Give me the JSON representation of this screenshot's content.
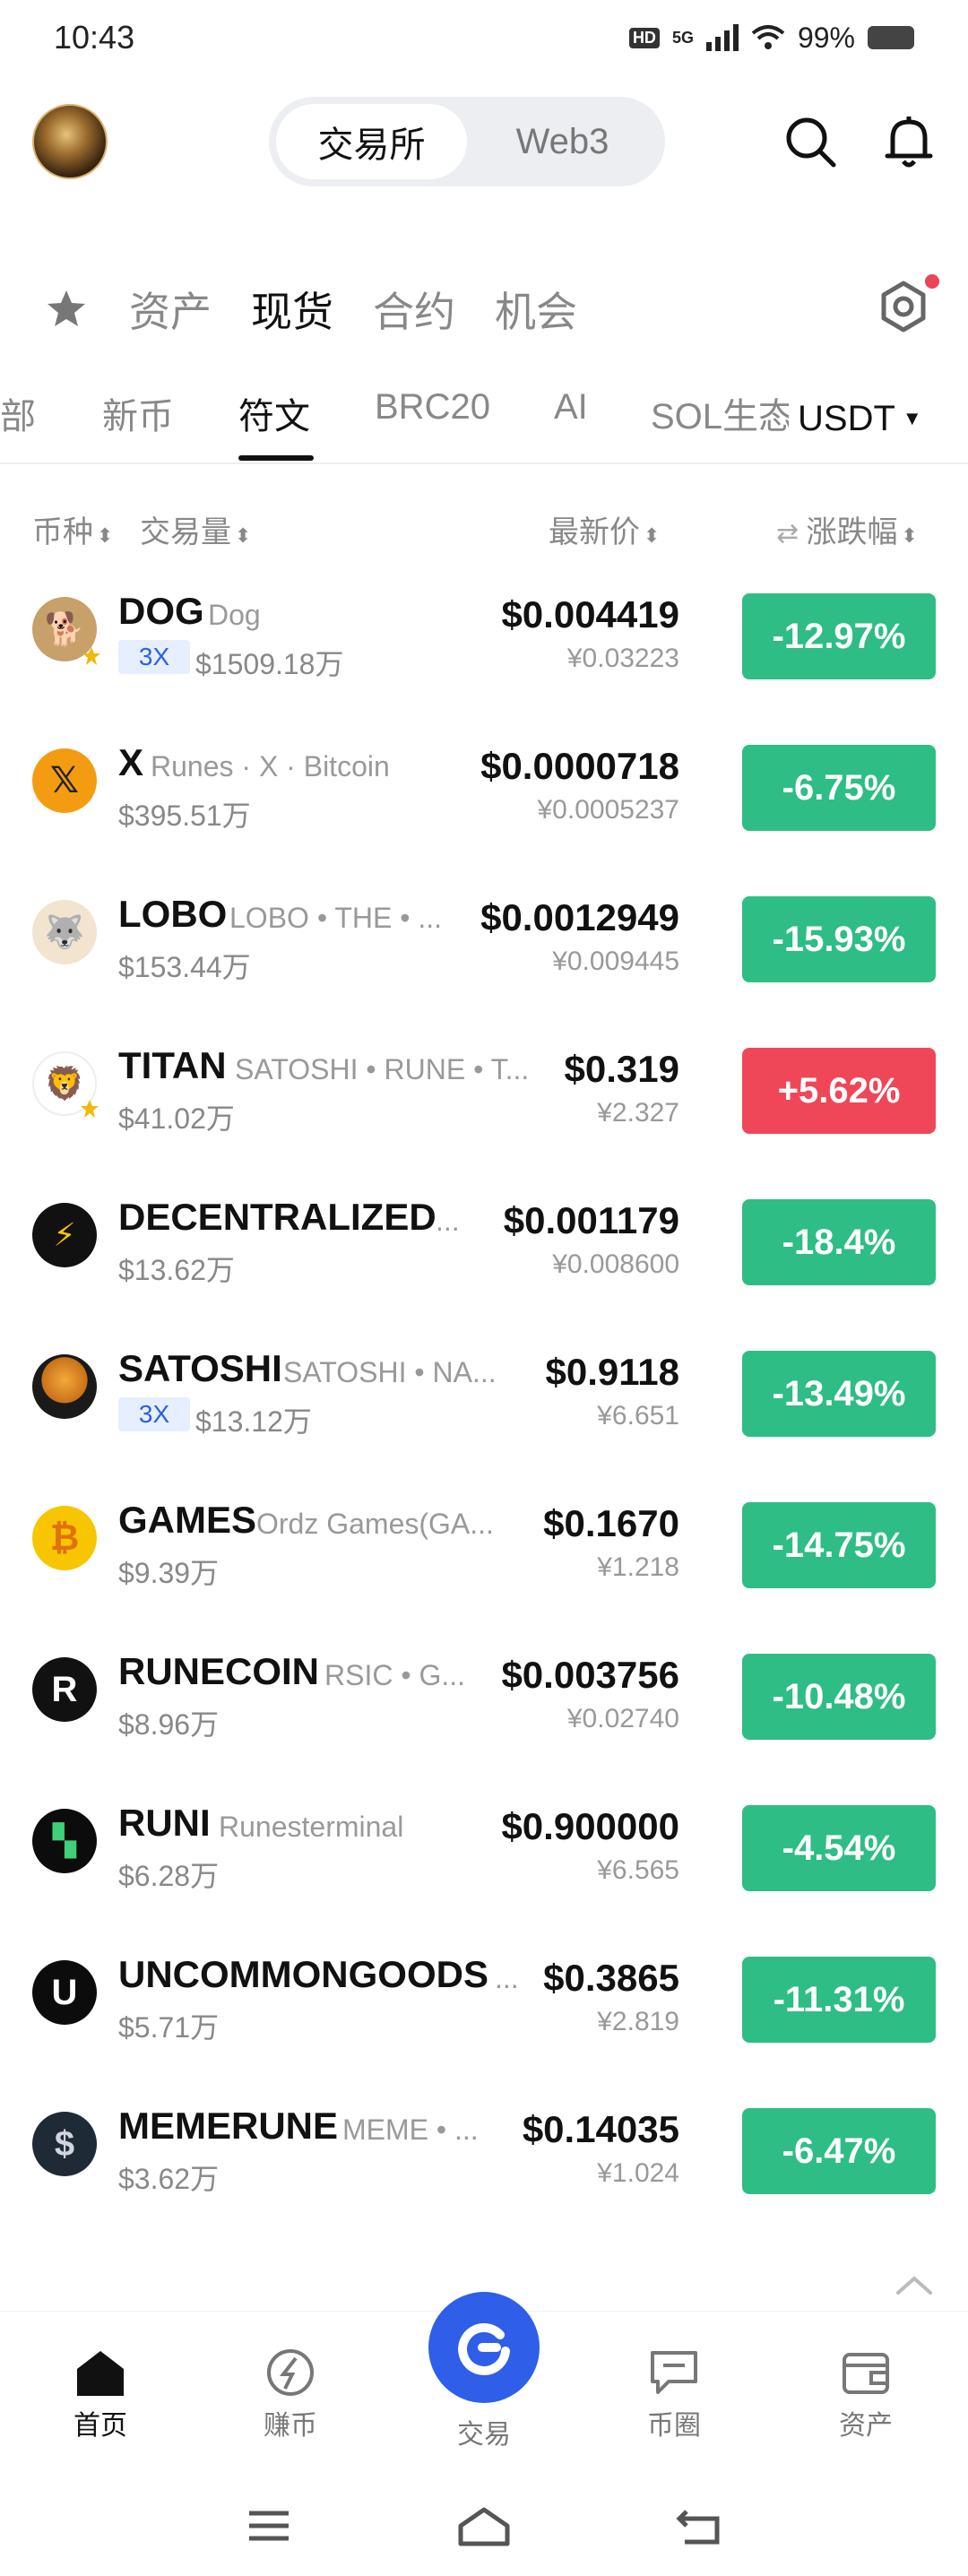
{
  "status_bar": {
    "time": "10:43",
    "network_hd": "HD",
    "network_5g": "5G",
    "battery": "99%"
  },
  "header": {
    "segment": [
      "交易所",
      "Web3"
    ],
    "active_segment": "交易所"
  },
  "primary_tabs": [
    "资产",
    "现货",
    "合约",
    "机会"
  ],
  "active_primary_tab": "现货",
  "secondary_tabs": [
    "部",
    "新币",
    "符文",
    "BRC20",
    "AI",
    "SOL生态"
  ],
  "active_secondary_tab": "符文",
  "quote_currency": "USDT",
  "columns": {
    "coin": "币种",
    "volume": "交易量",
    "price": "最新价",
    "change": "涨跌幅"
  },
  "rows": [
    {
      "symbol": "DOG",
      "name": "Dog",
      "leverage": "3X",
      "volume": "$1509.18万",
      "price": "$0.004419",
      "cny": "¥0.03223",
      "change": "-12.97%",
      "dir": "down"
    },
    {
      "symbol": "X",
      "name": "Runes · X · Bitcoin",
      "leverage": "",
      "volume": "$395.51万",
      "price": "$0.0000718",
      "cny": "¥0.0005237",
      "change": "-6.75%",
      "dir": "down"
    },
    {
      "symbol": "LOBO",
      "name": "LOBO • THE • ...",
      "leverage": "",
      "volume": "$153.44万",
      "price": "$0.0012949",
      "cny": "¥0.009445",
      "change": "-15.93%",
      "dir": "down"
    },
    {
      "symbol": "TITAN",
      "name": "SATOSHI • RUNE • T...",
      "leverage": "",
      "volume": "$41.02万",
      "price": "$0.319",
      "cny": "¥2.327",
      "change": "+5.62%",
      "dir": "up"
    },
    {
      "symbol": "DECENTRALIZED",
      "name": "...",
      "leverage": "",
      "volume": "$13.62万",
      "price": "$0.001179",
      "cny": "¥0.008600",
      "change": "-18.4%",
      "dir": "down"
    },
    {
      "symbol": "SATOSHI",
      "name": "SATOSHI • NA...",
      "leverage": "3X",
      "volume": "$13.12万",
      "price": "$0.9118",
      "cny": "¥6.651",
      "change": "-13.49%",
      "dir": "down"
    },
    {
      "symbol": "GAMES",
      "name": "Ordz Games(GA...",
      "leverage": "",
      "volume": "$9.39万",
      "price": "$0.1670",
      "cny": "¥1.218",
      "change": "-14.75%",
      "dir": "down"
    },
    {
      "symbol": "RUNECOIN",
      "name": "RSIC • G...",
      "leverage": "",
      "volume": "$8.96万",
      "price": "$0.003756",
      "cny": "¥0.02740",
      "change": "-10.48%",
      "dir": "down"
    },
    {
      "symbol": "RUNI",
      "name": "Runesterminal",
      "leverage": "",
      "volume": "$6.28万",
      "price": "$0.900000",
      "cny": "¥6.565",
      "change": "-4.54%",
      "dir": "down"
    },
    {
      "symbol": "UNCOMMONGOODS",
      "name": "...",
      "leverage": "",
      "volume": "$5.71万",
      "price": "$0.3865",
      "cny": "¥2.819",
      "change": "-11.31%",
      "dir": "down"
    },
    {
      "symbol": "MEMERUNE",
      "name": "MEME • ...",
      "leverage": "",
      "volume": "$3.62万",
      "price": "$0.14035",
      "cny": "¥1.024",
      "change": "-6.47%",
      "dir": "down"
    }
  ],
  "bottom_nav": [
    "首页",
    "赚币",
    "交易",
    "币圈",
    "资产"
  ],
  "active_nav": "首页",
  "colors": {
    "down": "#2ebd85",
    "up": "#ef4758",
    "accent": "#2f5ee8"
  }
}
